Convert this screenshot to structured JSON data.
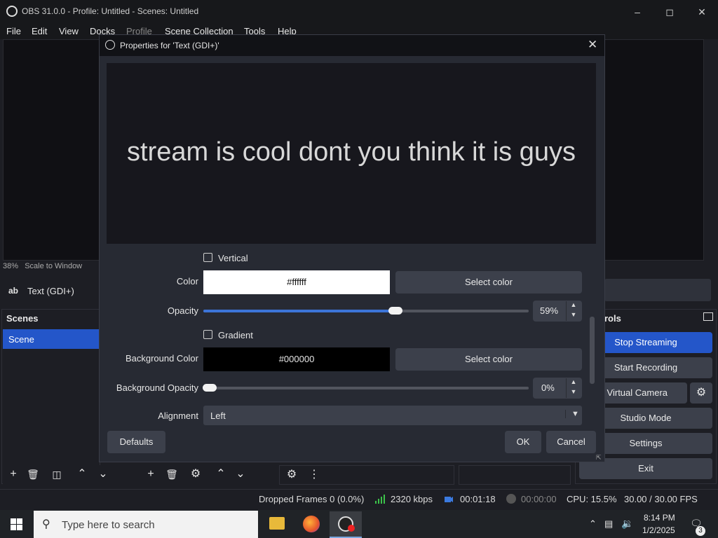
{
  "window": {
    "title": "OBS 31.0.0 - Profile: Untitled - Scenes: Untitled"
  },
  "menu": [
    "File",
    "Edit",
    "View",
    "Docks",
    "Profile",
    "Scene Collection",
    "Tools",
    "Help"
  ],
  "preview": {
    "zoom": "38%",
    "scale_mode": "Scale to Window"
  },
  "source": {
    "icon_text": "ab",
    "name": "Text (GDI+)"
  },
  "scenes": {
    "title": "Scenes",
    "items": [
      "Scene"
    ]
  },
  "controls": {
    "title_partial": "rols",
    "stop_streaming": "Stop Streaming",
    "start_recording": "Start Recording",
    "virtual_camera": "rt Virtual Camera",
    "studio_mode": "Studio Mode",
    "settings": "Settings",
    "exit": "Exit"
  },
  "dialog": {
    "title": "Properties for 'Text (GDI+)'",
    "preview_text": "stream is cool dont you think it is guys",
    "vertical_label": "Vertical",
    "color_label": "Color",
    "color_value": "#ffffff",
    "select_color": "Select color",
    "opacity_label": "Opacity",
    "opacity_value": "59%",
    "opacity_fraction": 0.59,
    "gradient_label": "Gradient",
    "bg_color_label": "Background Color",
    "bg_color_value": "#000000",
    "bg_opacity_label": "Background Opacity",
    "bg_opacity_value": "0%",
    "alignment_label": "Alignment",
    "alignment_value": "Left",
    "defaults": "Defaults",
    "ok": "OK",
    "cancel": "Cancel"
  },
  "statusbar": {
    "dropped": "Dropped Frames 0 (0.0%)",
    "bitrate": "2320 kbps",
    "stream_time": "00:01:18",
    "rec_time": "00:00:00",
    "cpu": "CPU: 15.5%",
    "fps": "30.00 / 30.00 FPS"
  },
  "taskbar": {
    "search_placeholder": "Type here to search",
    "time": "8:14 PM",
    "date": "1/2/2025",
    "notifications": "3"
  },
  "colors": {
    "accent": "#2456c9",
    "slider": "#3c74d8"
  }
}
